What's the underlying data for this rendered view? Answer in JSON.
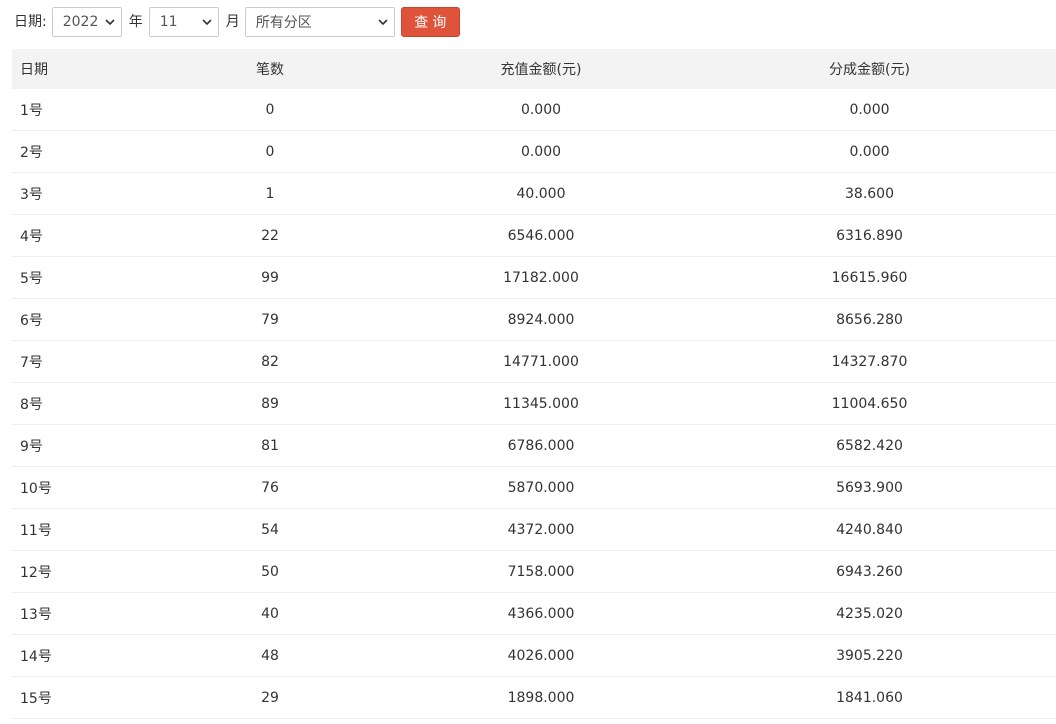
{
  "filter": {
    "date_label": "日期:",
    "year_value": "2022",
    "year_suffix": "年",
    "month_value": "11",
    "month_suffix": "月",
    "zone_value": "所有分区",
    "query_label": "查询"
  },
  "table": {
    "headers": [
      "日期",
      "笔数",
      "充值金额(元)",
      "分成金额(元)"
    ],
    "rows": [
      [
        "1号",
        "0",
        "0.000",
        "0.000"
      ],
      [
        "2号",
        "0",
        "0.000",
        "0.000"
      ],
      [
        "3号",
        "1",
        "40.000",
        "38.600"
      ],
      [
        "4号",
        "22",
        "6546.000",
        "6316.890"
      ],
      [
        "5号",
        "99",
        "17182.000",
        "16615.960"
      ],
      [
        "6号",
        "79",
        "8924.000",
        "8656.280"
      ],
      [
        "7号",
        "82",
        "14771.000",
        "14327.870"
      ],
      [
        "8号",
        "89",
        "11345.000",
        "11004.650"
      ],
      [
        "9号",
        "81",
        "6786.000",
        "6582.420"
      ],
      [
        "10号",
        "76",
        "5870.000",
        "5693.900"
      ],
      [
        "11号",
        "54",
        "4372.000",
        "4240.840"
      ],
      [
        "12号",
        "50",
        "7158.000",
        "6943.260"
      ],
      [
        "13号",
        "40",
        "4366.000",
        "4235.020"
      ],
      [
        "14号",
        "48",
        "4026.000",
        "3905.220"
      ],
      [
        "15号",
        "29",
        "1898.000",
        "1841.060"
      ]
    ]
  },
  "icons": {
    "select_arrow": "chevron-down-icon"
  }
}
